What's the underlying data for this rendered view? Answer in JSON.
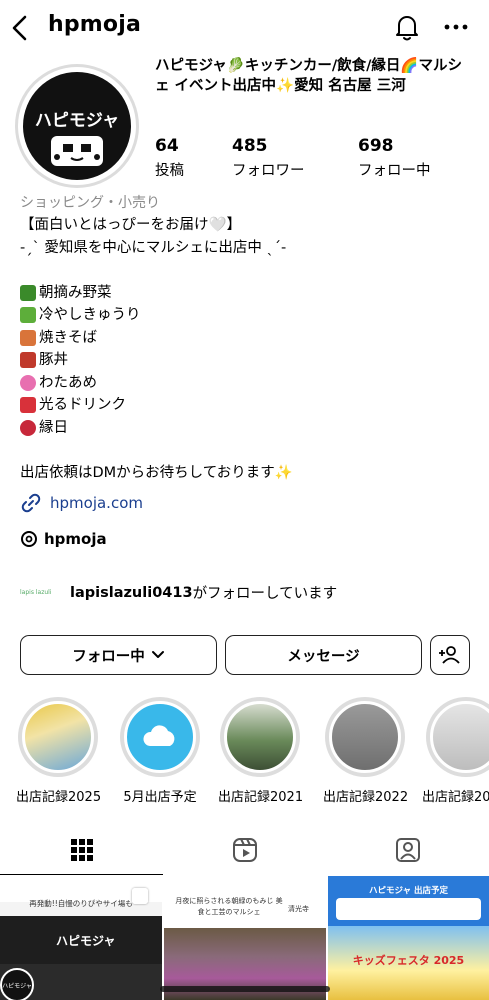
{
  "header": {
    "username": "hpmoja"
  },
  "profile": {
    "avatar_text": "ハピモジャ",
    "display_name": "ハピモジャ🥬キッチンカー/飲食/縁日🌈マルシェ イベント出店中✨愛知 名古屋 三河",
    "stats": [
      {
        "value": "64",
        "label": "投稿"
      },
      {
        "value": "485",
        "label": "フォロワー"
      },
      {
        "value": "698",
        "label": "フォロー中"
      }
    ],
    "category": "ショッピング・小売り",
    "bio_lines": [
      {
        "emoji_color": "",
        "text": "【面白いとはっぴーをお届け🤍】"
      },
      {
        "emoji_color": "",
        "text": "-ˏˋ 愛知県を中心にマルシェに出店中 ˎˊ-"
      },
      {
        "emoji_color": "",
        "text": ""
      },
      {
        "emoji_color": "#3a8a2a",
        "text": "朝摘み野菜"
      },
      {
        "emoji_color": "#5dae3a",
        "text": "冷やしきゅうり"
      },
      {
        "emoji_color": "#d9743a",
        "text": "焼きそば"
      },
      {
        "emoji_color": "#c0392b",
        "text": "豚丼"
      },
      {
        "emoji_color": "#e86fb0",
        "text": "わたあめ"
      },
      {
        "emoji_color": "#d8313a",
        "text": "光るドリンク"
      },
      {
        "emoji_color": "#c7283a",
        "text": "縁日"
      },
      {
        "emoji_color": "",
        "text": ""
      },
      {
        "emoji_color": "",
        "text": "出店依頼はDMからお待ちしております✨"
      }
    ],
    "link": "hpmoja.com",
    "threads_handle": "hpmoja",
    "followed_by_mini": "lapis lazuli",
    "followed_by_user": "lapislazuli0413",
    "followed_by_suffix": "がフォローしています"
  },
  "buttons": {
    "follow": "フォロー中",
    "message": "メッセージ"
  },
  "highlights": [
    {
      "label": "出店記録2025",
      "color": "#e9c84a"
    },
    {
      "label": "5月出店予定",
      "color": "#39b8ea"
    },
    {
      "label": "出店記録2021",
      "color": "#6a8a5a"
    },
    {
      "label": "出店記録2022",
      "color": "#8a8a8a"
    },
    {
      "label": "出店記録20",
      "color": "#cfcfcf"
    }
  ],
  "posts": [
    {
      "title": "ハピモジャ",
      "caption": "再発動!!自慢のりぴやサイ場も",
      "logo": "ハピモジャ",
      "color": "#222"
    },
    {
      "title": "清光寺",
      "caption": "月夜に照らされる朝緑のもみじ 美食と工芸のマルシェ",
      "color": "#7a5a6a"
    },
    {
      "title": "ハピモジャ 出店予定",
      "caption": "キッズフェスタ 2025",
      "color": "#2a7ad8"
    }
  ],
  "colors": {
    "link": "#1b3f8f",
    "category": "#8a8a8a"
  }
}
